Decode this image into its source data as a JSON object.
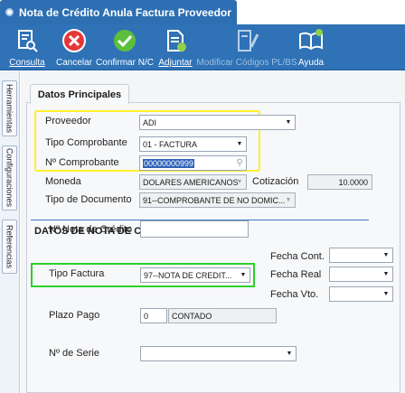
{
  "window": {
    "title": "Nota de Crédito Anula Factura Proveedor"
  },
  "toolbar": {
    "consulta": "Consulta",
    "cancelar": "Cancelar",
    "confirmar": "Confirmar N/C",
    "adjuntar": "Adjuntar",
    "modificar": "Modificar Códigos PL/BS",
    "ayuda": "Ayuda"
  },
  "sidebar": {
    "tabs": [
      "Herramientas",
      "Configuraciones",
      "Referencias"
    ]
  },
  "tab": {
    "label": "Datos Principales"
  },
  "form": {
    "proveedor_label": "Proveedor",
    "proveedor_value": "ADI",
    "tipo_comprobante_label": "Tipo Comprobante",
    "tipo_comprobante_value": "01 - FACTURA",
    "nro_comprobante_label": "Nº Comprobante",
    "nro_comprobante_value": "00000000999",
    "moneda_label": "Moneda",
    "moneda_value": "DOLARES AMERICANOS",
    "cotizacion_label": "Cotización",
    "cotizacion_value": "10.0000",
    "tipo_documento_label": "Tipo de Documento",
    "tipo_documento_value": "91--COMPROBANTE DE NO DOMIC..."
  },
  "nota": {
    "section_title": "DATOS DE NOTA DE CRÉDITO",
    "nro_nota_label": "Nº Nota de Crédito",
    "nro_nota_value": "",
    "tipo_factura_label": "Tipo Factura",
    "tipo_factura_value": "97--NOTA DE CREDIT...",
    "plazo_pago_label": "Plazo Pago",
    "plazo_pago_value": "0",
    "plazo_pago_desc": "CONTADO",
    "nro_serie_label": "Nº de Serie",
    "fecha_cont_label": "Fecha Cont.",
    "fecha_real_label": "Fecha Real",
    "fecha_vto_label": "Fecha Vto."
  }
}
